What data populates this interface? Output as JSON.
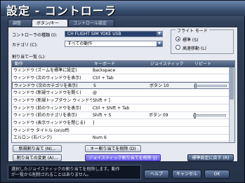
{
  "window": {
    "title": "設定 - コントローラ"
  },
  "tabs": [
    {
      "label": "調整"
    },
    {
      "label": "ボタン/キー"
    },
    {
      "label": "コントロール設定"
    }
  ],
  "device": {
    "label": "コントローラの種類 (I):",
    "value": "CH FLIGHT SIM YOKE USB"
  },
  "category": {
    "label": "カテゴリ (C):",
    "value": "すべての動作"
  },
  "flight_mode": {
    "title": "フライト モード",
    "options": [
      {
        "label": "標準 (S)",
        "selected": true
      },
      {
        "label": "高速移動 (L)",
        "selected": false
      }
    ]
  },
  "list": {
    "label": "割り当て一覧 (L):",
    "columns": [
      "動作",
      "キーボード",
      "ジョイスティック",
      "リピート"
    ],
    "rows": [
      {
        "action": "ウィンドウ (ズームを標準に設定)",
        "key": "Backspace",
        "joystick": "",
        "repeat": false
      },
      {
        "action": "ウィンドウ (次のウィンドウを表示)",
        "key": "Ctrl + Tab",
        "joystick": "",
        "repeat": false
      },
      {
        "action": "ウィンドウ (次のカテゴリを表示)",
        "key": "S",
        "joystick": "ボタン 10",
        "repeat": true
      },
      {
        "action": "ウィンドウ (新規ウィンドウを開く)",
        "key": "@",
        "joystick": "",
        "repeat": false
      },
      {
        "action": "ウィンドウ (新規トップダウン ウィンドウ)",
        "key": "Shift + ]",
        "joystick": "",
        "repeat": false
      },
      {
        "action": "ウィンドウ (前のウィンドウを表示)",
        "key": "Ctrl + Shift + Tab",
        "joystick": "",
        "repeat": false
      },
      {
        "action": "ウィンドウ (前のカテゴリを表示)",
        "key": "Shift + S",
        "joystick": "ボタン 09",
        "repeat": true
      },
      {
        "action": "ウィンドウ (表示ウィンドウを閉じる)",
        "key": "]",
        "joystick": "",
        "repeat": false
      },
      {
        "action": "ウィンドウ タイトル (on/off)",
        "key": "",
        "joystick": "",
        "repeat": false
      },
      {
        "action": "エルロン (右バンク)",
        "key": "Num 6",
        "joystick": "",
        "repeat": false
      }
    ]
  },
  "buttons": {
    "new_key": "新規割り当て (N)...",
    "delete_key": "キー割り当てを削除 (D)",
    "change_key": "割り当ての変更 (A)...",
    "delete_joystick": "ジョイスティック割り当てを削除 (J)",
    "reset": "標準設定に戻す (R)"
  },
  "help_text": [
    "選択したジョイスティックの割り当てを削除します。動作",
    "が一覧から削除されることはありません。"
  ],
  "footer": {
    "help": "ヘルプ",
    "cancel": "キャンセル",
    "ok": "OK"
  }
}
